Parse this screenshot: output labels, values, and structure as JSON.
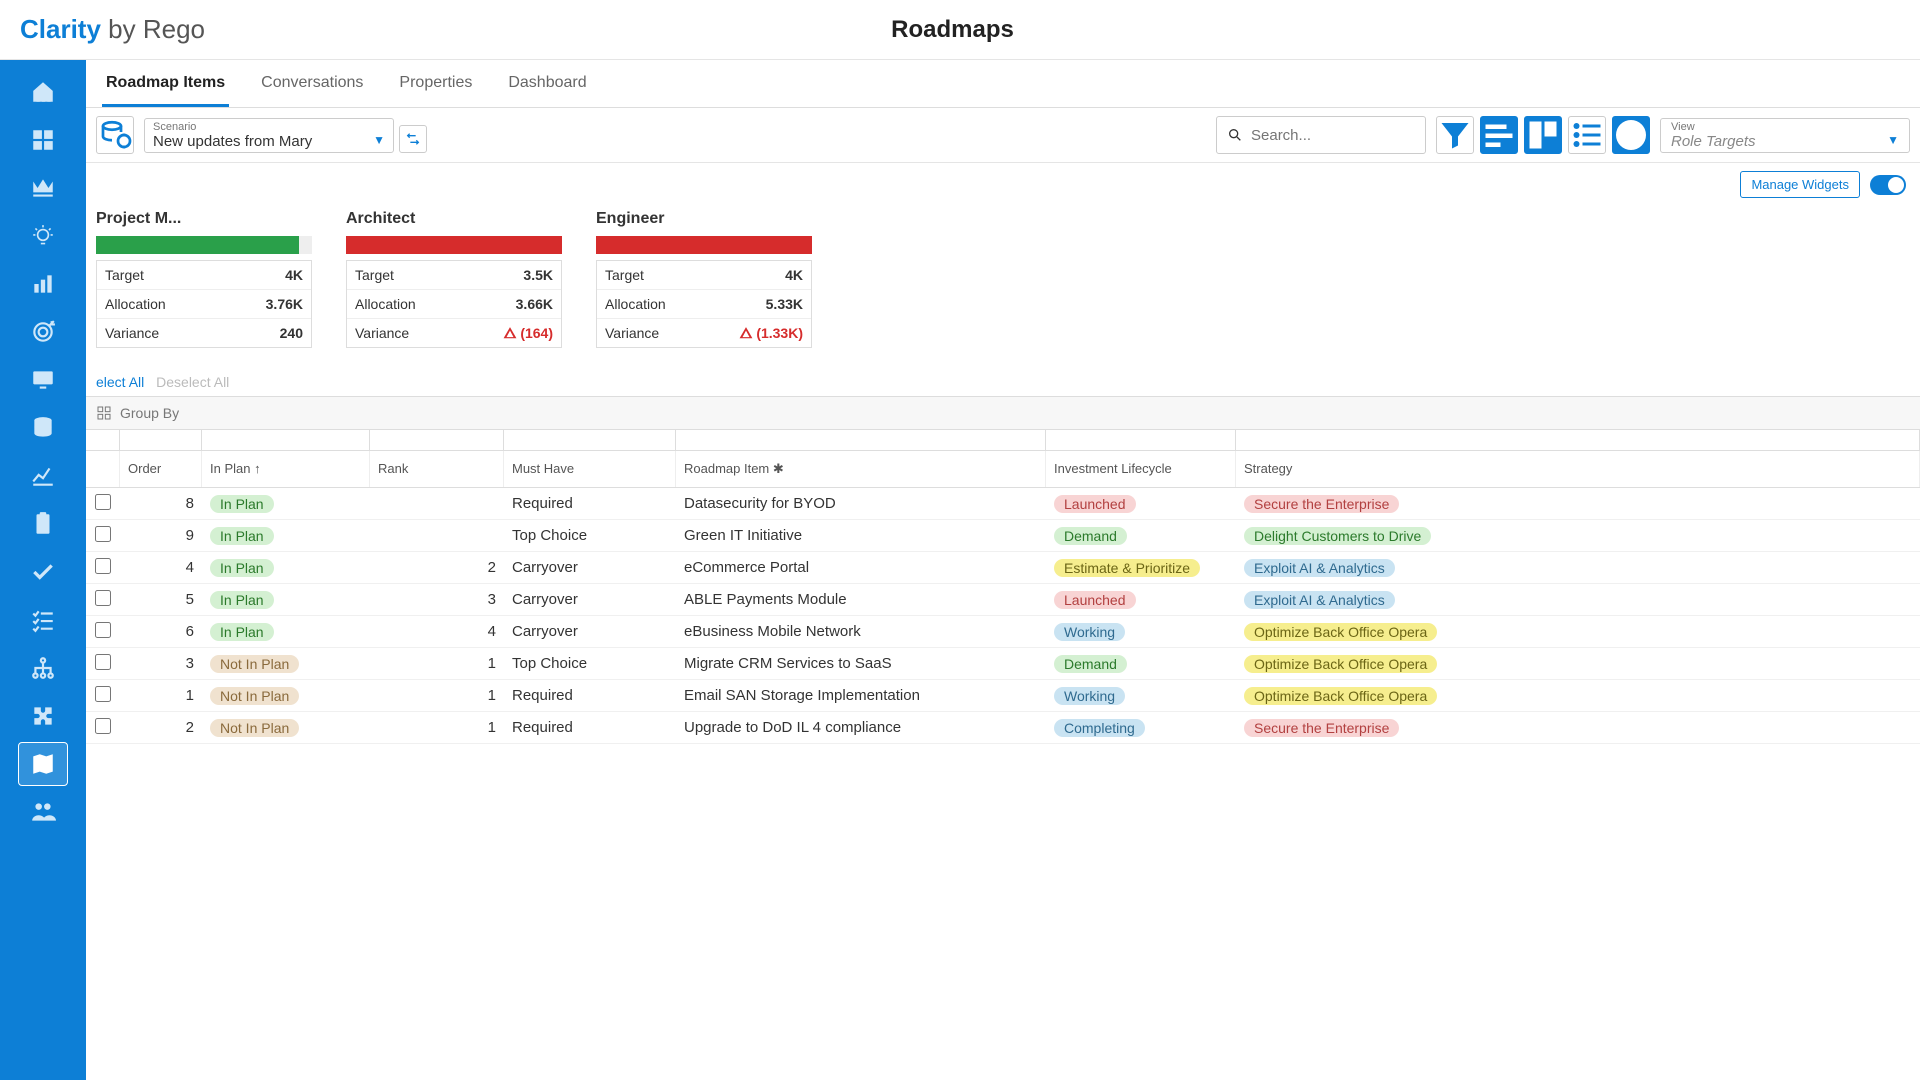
{
  "brand": {
    "clarity": "Clarity",
    "by": " by Rego"
  },
  "page_title": "Roadmaps",
  "tabs": [
    {
      "label": "Roadmap Items",
      "active": true
    },
    {
      "label": "Conversations"
    },
    {
      "label": "Properties"
    },
    {
      "label": "Dashboard"
    }
  ],
  "scenario": {
    "label": "Scenario",
    "value": "New updates from Mary"
  },
  "search": {
    "placeholder": "Search..."
  },
  "view": {
    "label": "View",
    "value": "Role Targets"
  },
  "manage_widgets_label": "Manage Widgets",
  "cards": [
    {
      "title": "Project M...",
      "color": "green",
      "fill": 94,
      "target": "4K",
      "alloc": "3.76K",
      "variance": "240",
      "warn": false
    },
    {
      "title": "Architect",
      "color": "red",
      "fill": 100,
      "target": "3.5K",
      "alloc": "3.66K",
      "variance": "(164)",
      "warn": true
    },
    {
      "title": "Engineer",
      "color": "red",
      "fill": 100,
      "target": "4K",
      "alloc": "5.33K",
      "variance": "(1.33K)",
      "warn": true
    }
  ],
  "card_labels": {
    "target": "Target",
    "allocation": "Allocation",
    "variance": "Variance"
  },
  "select_all": "elect All",
  "deselect_all": "Deselect All",
  "group_by_label": "Group By",
  "columns": {
    "order": "Order",
    "inplan": "In Plan ↑",
    "rank": "Rank",
    "must": "Must Have",
    "item": "Roadmap Item ✱",
    "life": "Investment Lifecycle",
    "strat": "Strategy"
  },
  "rows": [
    {
      "order": "8",
      "inplan": "In Plan",
      "inplan_c": "p-green",
      "rank": "",
      "must": "Required",
      "item": "Datasecurity for BYOD",
      "life": "Launched",
      "life_c": "p-pink",
      "strat": "Secure the Enterprise",
      "strat_c": "p-pink"
    },
    {
      "order": "9",
      "inplan": "In Plan",
      "inplan_c": "p-green",
      "rank": "",
      "must": "Top Choice",
      "item": "Green IT Initiative",
      "life": "Demand",
      "life_c": "p-green",
      "strat": "Delight Customers to Drive",
      "strat_c": "p-green"
    },
    {
      "order": "4",
      "inplan": "In Plan",
      "inplan_c": "p-green",
      "rank": "2",
      "must": "Carryover",
      "item": "eCommerce Portal",
      "life": "Estimate & Prioritize",
      "life_c": "p-yellow",
      "strat": "Exploit AI & Analytics",
      "strat_c": "p-blue"
    },
    {
      "order": "5",
      "inplan": "In Plan",
      "inplan_c": "p-green",
      "rank": "3",
      "must": "Carryover",
      "item": "ABLE Payments Module",
      "life": "Launched",
      "life_c": "p-pink",
      "strat": "Exploit AI & Analytics",
      "strat_c": "p-blue"
    },
    {
      "order": "6",
      "inplan": "In Plan",
      "inplan_c": "p-green",
      "rank": "4",
      "must": "Carryover",
      "item": "eBusiness Mobile Network",
      "life": "Working",
      "life_c": "p-blue",
      "strat": "Optimize Back Office Opera",
      "strat_c": "p-yellow"
    },
    {
      "order": "3",
      "inplan": "Not In Plan",
      "inplan_c": "p-tan",
      "rank": "1",
      "must": "Top Choice",
      "item": "Migrate CRM Services to SaaS",
      "life": "Demand",
      "life_c": "p-green",
      "strat": "Optimize Back Office Opera",
      "strat_c": "p-yellow"
    },
    {
      "order": "1",
      "inplan": "Not In Plan",
      "inplan_c": "p-tan",
      "rank": "1",
      "must": "Required",
      "item": "Email SAN Storage Implementation",
      "life": "Working",
      "life_c": "p-blue",
      "strat": "Optimize Back Office Opera",
      "strat_c": "p-yellow"
    },
    {
      "order": "2",
      "inplan": "Not In Plan",
      "inplan_c": "p-tan",
      "rank": "1",
      "must": "Required",
      "item": "Upgrade to DoD IL 4 compliance",
      "life": "Completing",
      "life_c": "p-blue",
      "strat": "Secure the Enterprise",
      "strat_c": "p-pink"
    }
  ]
}
